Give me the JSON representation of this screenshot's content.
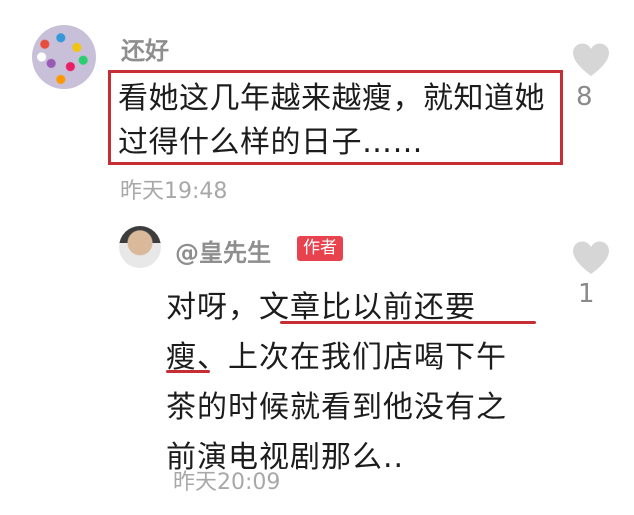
{
  "comment": {
    "username": "还好",
    "text": "看她这几年越来越瘦，就知道她过得什么样的日子……",
    "time": "昨天19:48",
    "likes": "8",
    "like_icon": "heart-icon",
    "highlight_color": "#c62d35"
  },
  "reply": {
    "username": "@皇先生",
    "badge": "作者",
    "badge_color": "#e8424f",
    "text": "对呀，文章比以前还要瘦、上次在我们店喝下午茶的时候就看到他没有之前演电视剧那么..",
    "time": "昨天20:09",
    "likes": "1",
    "like_icon": "heart-icon"
  }
}
